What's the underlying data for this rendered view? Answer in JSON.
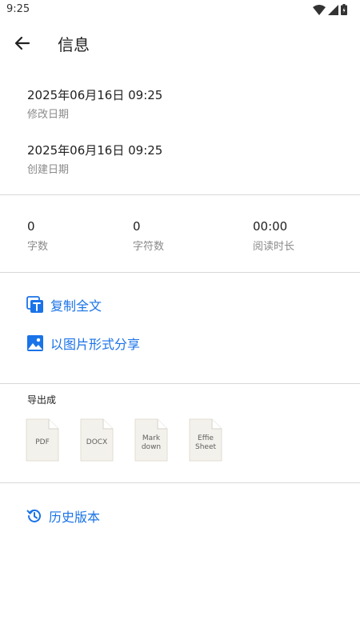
{
  "status_bar": {
    "time": "9:25"
  },
  "header": {
    "title": "信息"
  },
  "dates": {
    "modified": {
      "value": "2025年06月16日 09:25",
      "label": "修改日期"
    },
    "created": {
      "value": "2025年06月16日 09:25",
      "label": "创建日期"
    }
  },
  "stats": {
    "words": {
      "value": "0",
      "label": "字数"
    },
    "characters": {
      "value": "0",
      "label": "字符数"
    },
    "reading_time": {
      "value": "00:00",
      "label": "阅读时长"
    }
  },
  "actions": {
    "copy_all": "复制全文",
    "share_image": "以图片形式分享"
  },
  "export": {
    "title": "导出成",
    "formats": [
      {
        "line1": "PDF",
        "line2": ""
      },
      {
        "line1": "DOCX",
        "line2": ""
      },
      {
        "line1": "Mark",
        "line2": "down"
      },
      {
        "line1": "Effie",
        "line2": "Sheet"
      }
    ]
  },
  "history": {
    "label": "历史版本"
  },
  "colors": {
    "accent": "#1a73e8",
    "secondary_text": "#8a8a8a",
    "divider": "#d8d8d8"
  }
}
